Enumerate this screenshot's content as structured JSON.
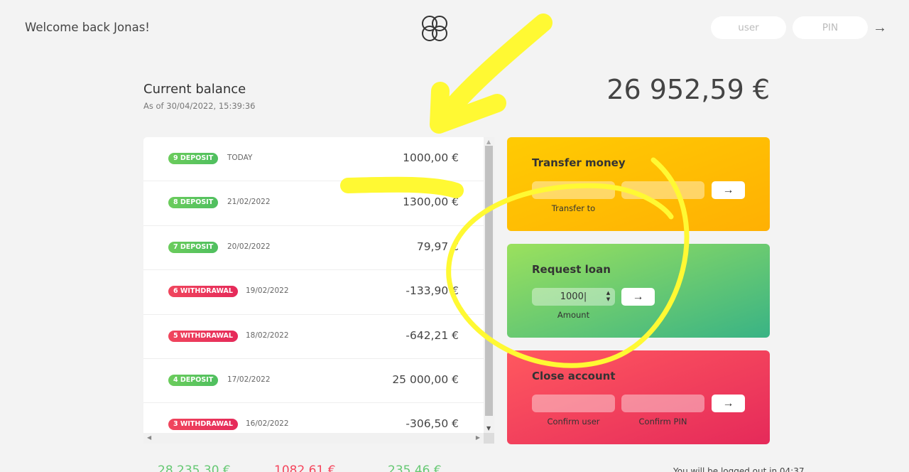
{
  "nav": {
    "welcome": "Welcome back Jonas!",
    "user_placeholder": "user",
    "pin_placeholder": "PIN",
    "login_arrow": "→"
  },
  "balance": {
    "label": "Current balance",
    "date": "As of 30/04/2022, 15:39:36",
    "value": "26 952,59 €"
  },
  "movements": [
    {
      "type": "9 deposit",
      "kind": "deposit",
      "date": "TODAY",
      "value": "1000,00 €"
    },
    {
      "type": "8 deposit",
      "kind": "deposit",
      "date": "21/02/2022",
      "value": "1300,00 €"
    },
    {
      "type": "7 deposit",
      "kind": "deposit",
      "date": "20/02/2022",
      "value": "79,97 €"
    },
    {
      "type": "6 withdrawal",
      "kind": "withdrawal",
      "date": "19/02/2022",
      "value": "-133,90 €"
    },
    {
      "type": "5 withdrawal",
      "kind": "withdrawal",
      "date": "18/02/2022",
      "value": "-642,21 €"
    },
    {
      "type": "4 deposit",
      "kind": "deposit",
      "date": "17/02/2022",
      "value": "25 000,00 €"
    },
    {
      "type": "3 withdrawal",
      "kind": "withdrawal",
      "date": "16/02/2022",
      "value": "-306,50 €"
    }
  ],
  "transfer": {
    "title": "Transfer money",
    "label_to": "Transfer to",
    "button": "→"
  },
  "loan": {
    "title": "Request loan",
    "amount_value": "1000",
    "label_amount": "Amount",
    "button": "→"
  },
  "close": {
    "title": "Close account",
    "label_user": "Confirm user",
    "label_pin": "Confirm PIN",
    "button": "→"
  },
  "summary": {
    "in": "28 235,30 €",
    "out": "1082,61 €",
    "interest": "235,46 €",
    "timer": "You will be logged out in 04:37"
  },
  "colors": {
    "deposit": "#4fbf5f",
    "withdrawal": "#e52a5a",
    "transfer": "#ffb003",
    "loan": "#39b385",
    "close": "#ff585f",
    "annotation": "#fff933"
  }
}
